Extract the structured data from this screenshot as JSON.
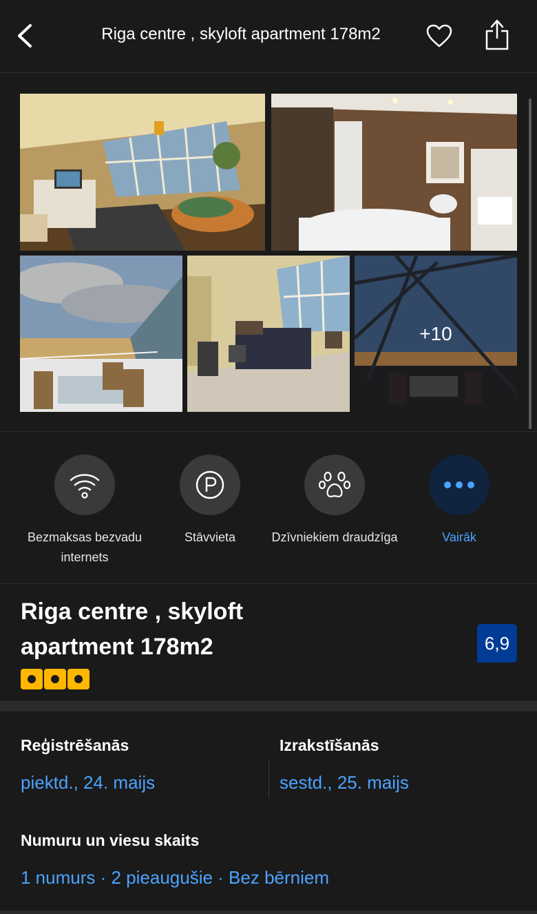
{
  "header": {
    "title": "Riga centre , skyloft apartment 178m2",
    "back_icon": "chevron-left-icon",
    "favorite_icon": "heart-icon",
    "share_icon": "share-icon"
  },
  "gallery": {
    "more_photos_label": "+10",
    "photos": [
      "living-room",
      "bathroom",
      "terrace",
      "bedroom",
      "terrace-sunset"
    ]
  },
  "facilities": [
    {
      "label": "Bezmaksas bezvadu internets",
      "icon": "wifi-icon"
    },
    {
      "label": "Stāvvieta",
      "icon": "parking-icon"
    },
    {
      "label": "Dzīvniekiem draudzīga",
      "icon": "paw-icon"
    },
    {
      "label": "Vairāk",
      "icon": "more-dots-icon"
    }
  ],
  "property": {
    "name": "Riga centre , skyloft apartment 178m2",
    "rating_stars": 3,
    "review_score": "6,9"
  },
  "booking": {
    "checkin_label": "Reģistrēšanās",
    "checkin_value": "piektd., 24. maijs",
    "checkout_label": "Izrakstīšanās",
    "checkout_value": "sestd., 25. maijs",
    "rooms_label": "Numuru un viesu skaits",
    "rooms_value": "1 numurs · 2 pieaugušie · Bez bērniem"
  },
  "colors": {
    "background": "#1a1a1a",
    "accent_blue": "#4ba3ff",
    "score_blue": "#003b95",
    "star_yellow": "#ffb700"
  }
}
